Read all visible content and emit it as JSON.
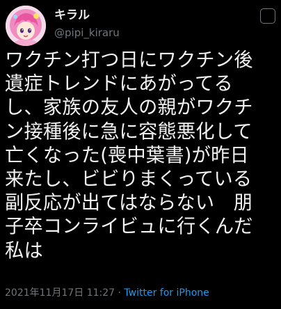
{
  "user": {
    "display_name": "キラル",
    "handle": "@pipi_kiraru"
  },
  "tweet": {
    "lines": [
      "ワクチン打つ日にワクチン後",
      "遺症トレンドにあがってる",
      "し、家族の友人の親がワクチ",
      "ン接種後に急に容態悪化して",
      "亡くなった(喪中葉書)が昨日",
      "来たし、ビビりまくっている",
      "副反応が出てはならない　朋",
      "子卒コンライビュに行くんだ",
      "私は"
    ],
    "timestamp": "2021年11月17日 11:27",
    "separator": "·",
    "source": "Twitter for iPhone"
  },
  "colors": {
    "background": "#000000",
    "text": "#e7e9ea",
    "muted": "#71767b",
    "link": "#1d9bf0"
  },
  "icons": {
    "avatar": "avatar-pink-hair-character",
    "more": "more-options-icon"
  }
}
